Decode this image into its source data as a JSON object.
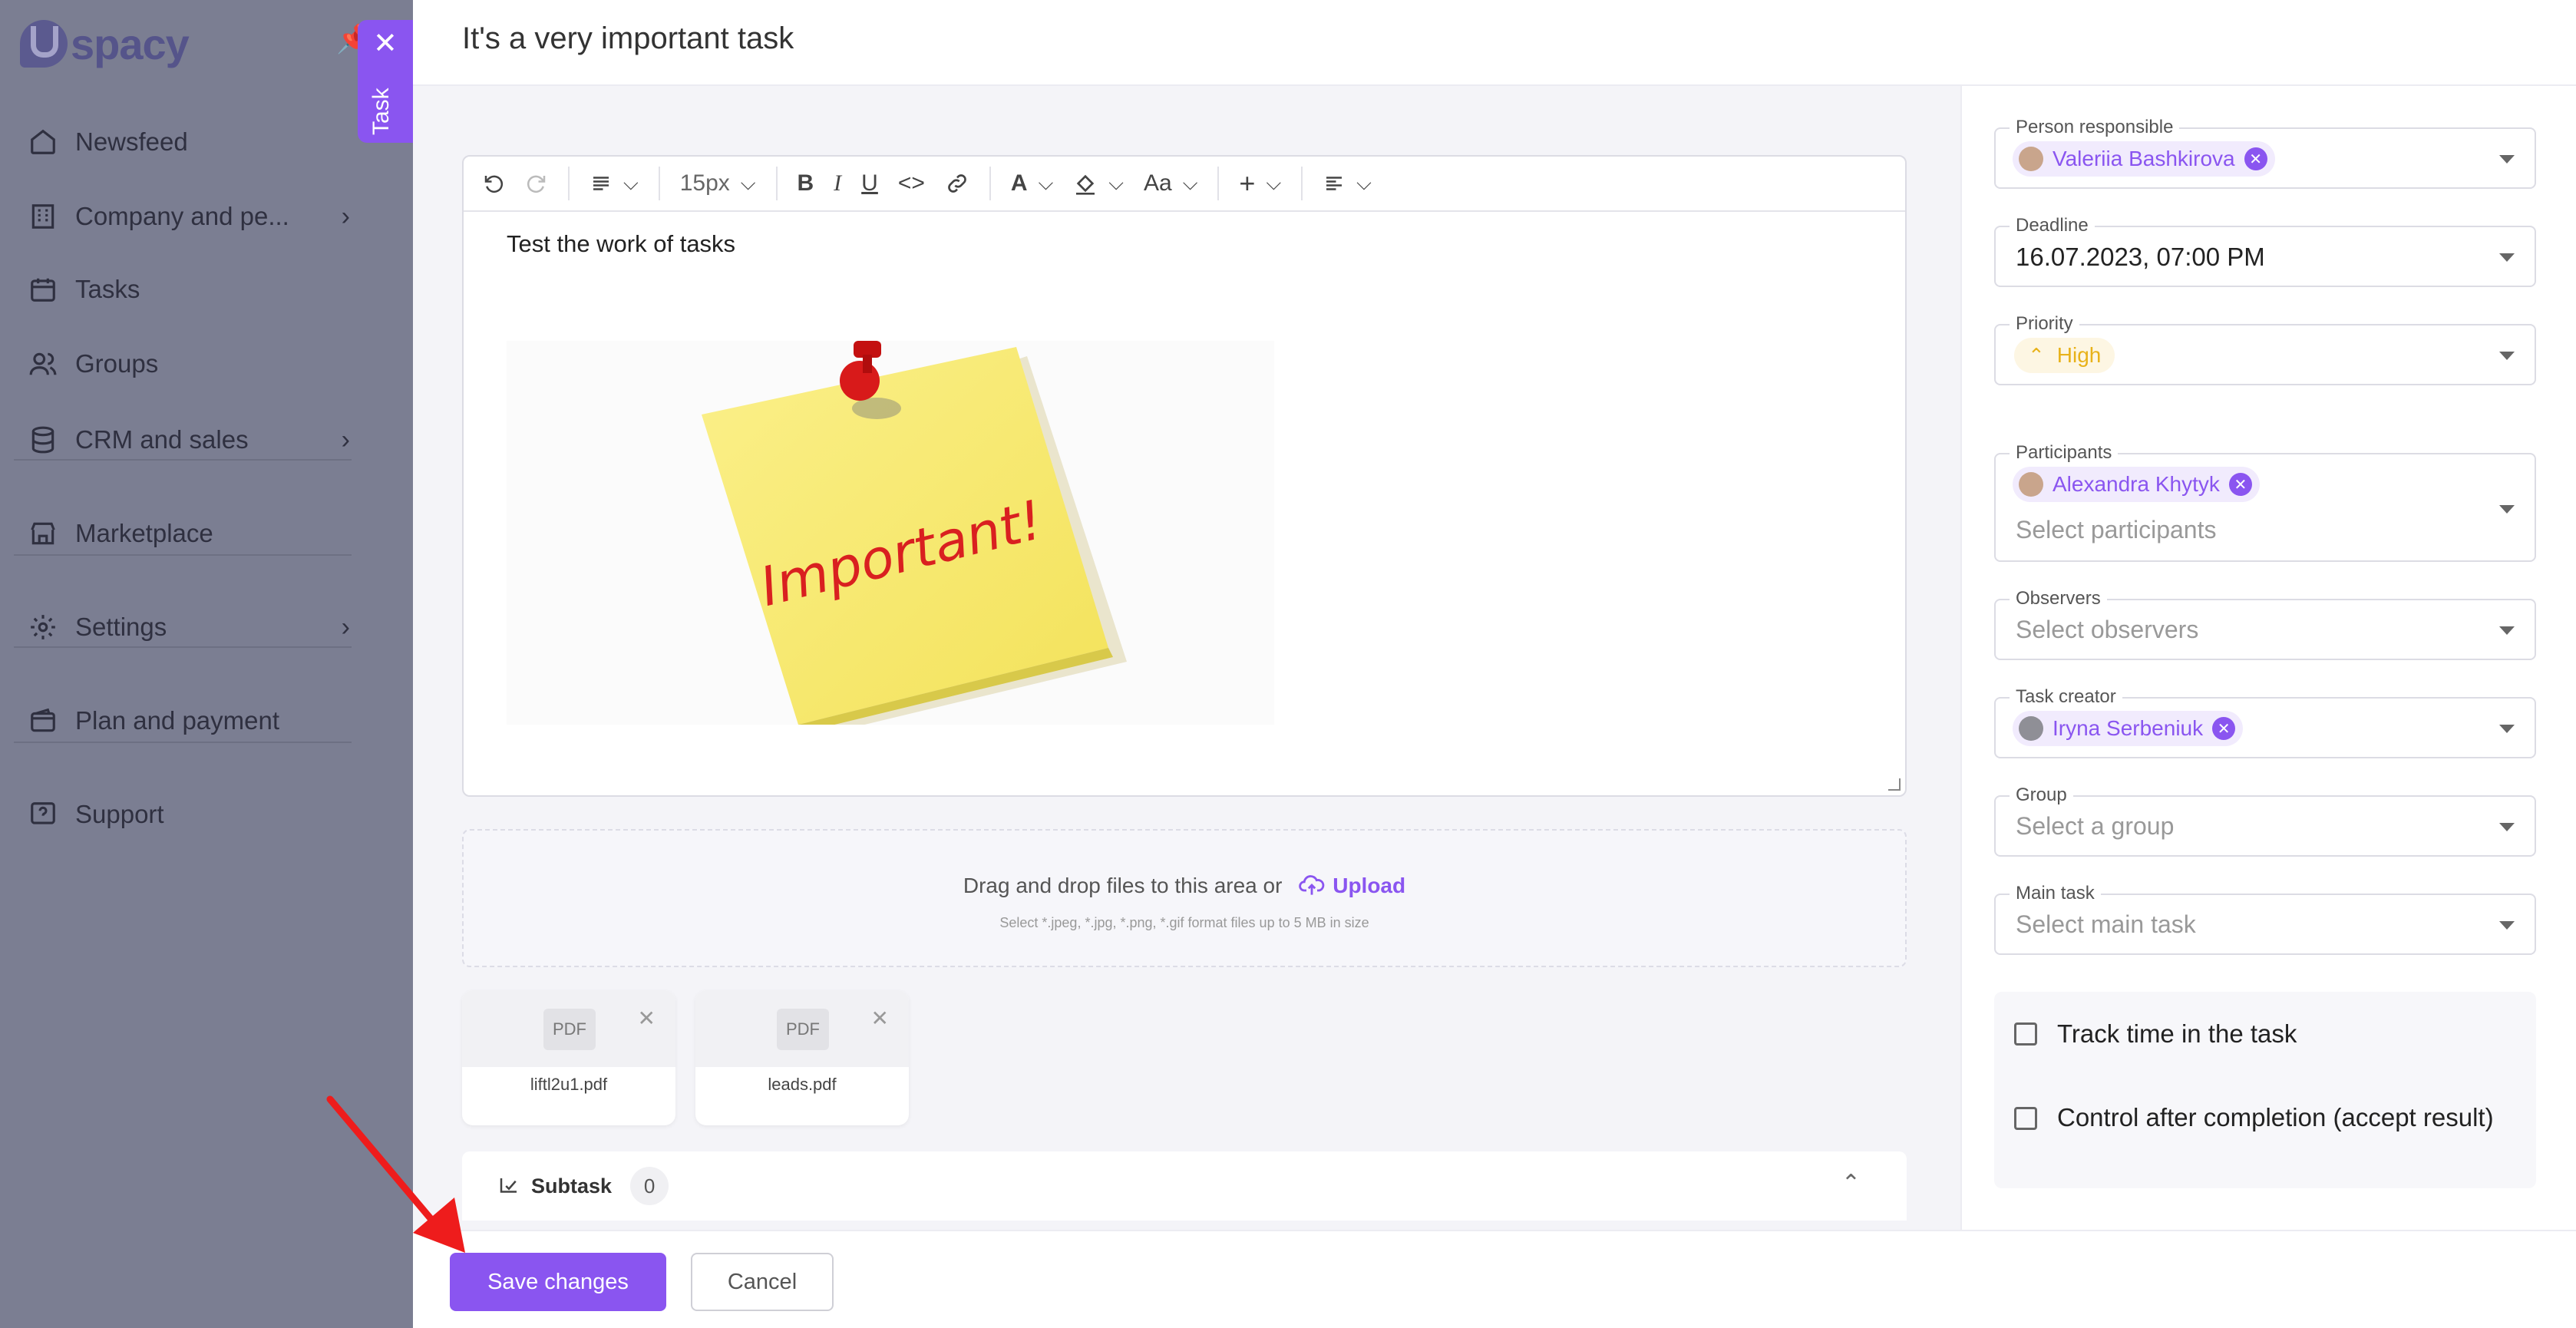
{
  "sidebar": {
    "logo_text": "spacy",
    "items": [
      {
        "label": "Newsfeed",
        "icon": "home-icon",
        "has_chevron": false
      },
      {
        "label": "Company and pe...",
        "icon": "building-icon",
        "has_chevron": true
      },
      {
        "label": "Tasks",
        "icon": "calendar-icon",
        "has_chevron": false
      },
      {
        "label": "Groups",
        "icon": "users-icon",
        "has_chevron": false
      },
      {
        "label": "CRM and sales",
        "icon": "database-icon",
        "has_chevron": true
      },
      {
        "label": "Marketplace",
        "icon": "store-icon",
        "has_chevron": false
      },
      {
        "label": "Settings",
        "icon": "gear-icon",
        "has_chevron": true
      },
      {
        "label": "Plan and payment",
        "icon": "wallet-icon",
        "has_chevron": false
      },
      {
        "label": "Support",
        "icon": "help-icon",
        "has_chevron": false
      }
    ]
  },
  "task_tab": {
    "label": "Task"
  },
  "header": {
    "title": "It's a very important task"
  },
  "editor": {
    "font_size": "15px",
    "text": "Test the work of tasks",
    "image_caption": "Important!"
  },
  "dropzone": {
    "text": "Drag and drop files to this area or",
    "upload_label": "Upload",
    "hint": "Select *.jpeg, *.jpg, *.png, *.gif format files up to 5 MB in size"
  },
  "files": [
    {
      "type": "PDF",
      "name": "liftl2u1.pdf"
    },
    {
      "type": "PDF",
      "name": "leads.pdf"
    }
  ],
  "subtask": {
    "label": "Subtask",
    "count": "0"
  },
  "footer": {
    "save_label": "Save changes",
    "cancel_label": "Cancel"
  },
  "right": {
    "person_responsible": {
      "label": "Person responsible",
      "value": "Valeriia Bashkirova"
    },
    "deadline": {
      "label": "Deadline",
      "value": "16.07.2023, 07:00 PM"
    },
    "priority": {
      "label": "Priority",
      "value": "High",
      "color": "#e8b21a"
    },
    "participants": {
      "label": "Participants",
      "value": "Alexandra Khytyk",
      "placeholder": "Select participants"
    },
    "observers": {
      "label": "Observers",
      "placeholder": "Select observers"
    },
    "task_creator": {
      "label": "Task creator",
      "value": "Iryna Serbeniuk"
    },
    "group": {
      "label": "Group",
      "placeholder": "Select a group"
    },
    "main_task": {
      "label": "Main task",
      "placeholder": "Select main task"
    },
    "track_time": {
      "label": "Track time in the task",
      "checked": false
    },
    "control": {
      "label": "Control after completion (accept result)",
      "checked": false
    }
  },
  "colors": {
    "accent": "#8a55f0",
    "sidebar_dim": "#7b7e92"
  }
}
